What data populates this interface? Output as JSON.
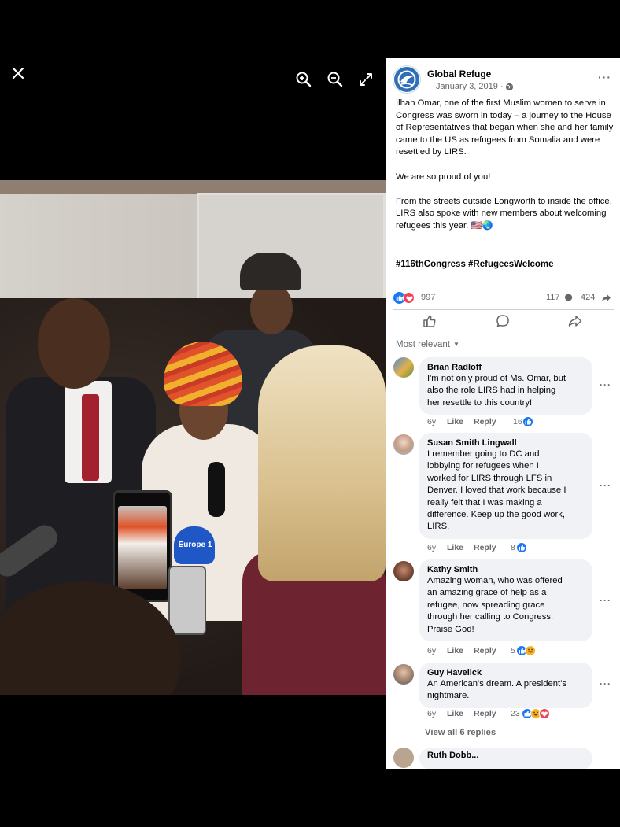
{
  "viewer": {
    "close_icon": "close-icon",
    "zoom_in_icon": "zoom-in-icon",
    "zoom_out_icon": "zoom-out-icon",
    "fullscreen_icon": "fullscreen-icon",
    "photo_sign_text": "Europe 1"
  },
  "post": {
    "page_name": "Global Refuge",
    "date": "January 3, 2019 ·",
    "paragraphs": [
      "Ilhan Omar, one of the first Muslim women to serve in Congress was sworn in today – a journey to the House of Representatives that began when she and her family came to the US as refugees from Somalia and were resettled by LIRS.",
      "We are so proud of you!",
      "From the streets outside Longworth to inside the office, LIRS also spoke with new members about welcoming refugees this year. 🇺🇸🌏"
    ],
    "hashtags": "#116thCongress #RefugeesWelcome",
    "reactions_count": "997",
    "comments_count": "117",
    "shares_count": "424"
  },
  "actions": {
    "like_icon": "thumbs-up-icon",
    "comment_icon": "comment-icon",
    "share_icon": "share-icon"
  },
  "comments_section": {
    "sort_label": "Most relevant",
    "view_replies": "View all 6 replies",
    "next_commenter_partial": "Ruth Dobb..."
  },
  "comments": [
    {
      "name": "Brian Radloff",
      "lines": [
        "I'm not only proud of Ms. Omar, but",
        "also the role LIRS had in helping",
        "her resettle to this country!"
      ],
      "age": "6y",
      "like": "Like",
      "reply": "Reply",
      "count": "16"
    },
    {
      "name": "Susan Smith Lingwall",
      "lines": [
        "I remember going to DC and",
        "lobbying for refugees when I",
        "worked for LIRS through LFS in",
        "Denver. I loved that work because I",
        "really felt that I was making a",
        "difference. Keep up the good work,",
        "LIRS."
      ],
      "age": "6y",
      "like": "Like",
      "reply": "Reply",
      "count": "8"
    },
    {
      "name": "Kathy Smith",
      "lines": [
        "Amazing woman, who was offered",
        "an amazing grace of help as a",
        "refugee, now spreading grace",
        "through her calling to Congress.",
        "Praise God!"
      ],
      "age": "6y",
      "like": "Like",
      "reply": "Reply",
      "count": "5"
    },
    {
      "name": "Guy Havelick",
      "lines": [
        "An American's dream. A president's",
        "nightmare."
      ],
      "age": "6y",
      "like": "Like",
      "reply": "Reply",
      "count": "23"
    }
  ],
  "colors": {
    "facebook_blue": "#1877f2",
    "love_red": "#f33e58",
    "haha_yellow": "#f7b125",
    "secondary_text": "#65676b",
    "bubble_bg": "#f0f2f5"
  }
}
